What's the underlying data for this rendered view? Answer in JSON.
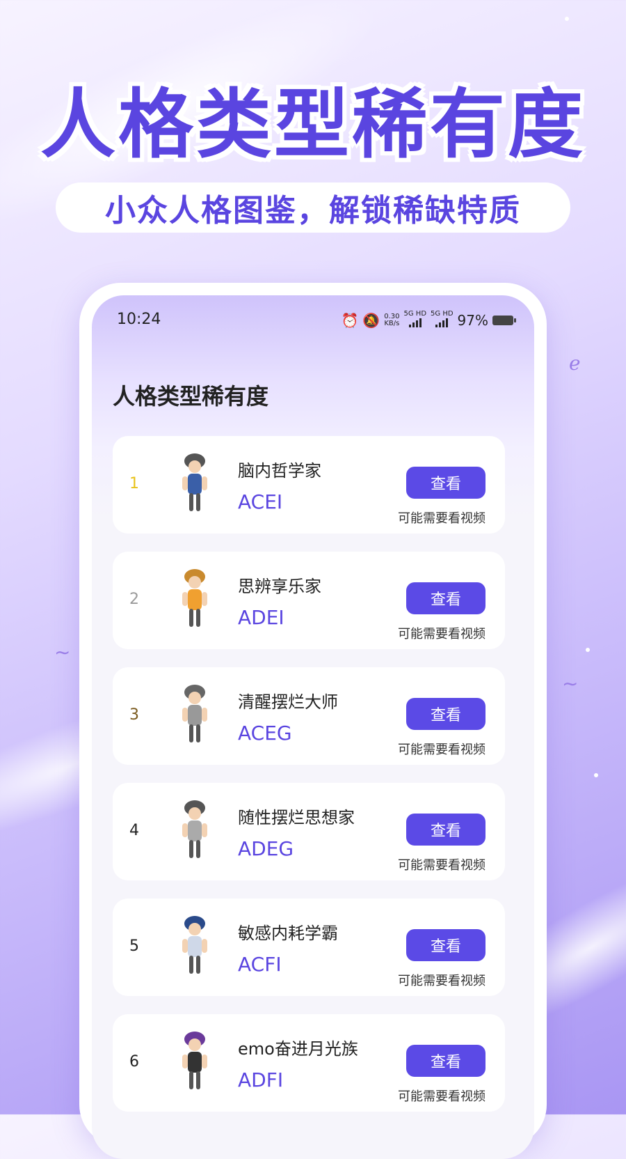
{
  "promo": {
    "headline": "人格类型稀有度",
    "subtitle": "小众人格图鉴，解锁稀缺特质"
  },
  "status_bar": {
    "time": "10:24",
    "speed_value": "0.30",
    "speed_unit": "KB/s",
    "net1": "5G HD",
    "net2": "5G HD",
    "battery": "97%"
  },
  "page_title": "人格类型稀有度",
  "colors": {
    "accent": "#5b4ae6",
    "rank1": "#e8c21a",
    "rank2": "#9a9a9a",
    "rank3": "#7a5a1e",
    "rank_default": "#222222"
  },
  "list": [
    {
      "rank": "1",
      "name": "脑内哲学家",
      "code": "ACEI",
      "button": "查看",
      "hint": "可能需要看视频",
      "icon": "avatar-philosopher-icon"
    },
    {
      "rank": "2",
      "name": "思辨享乐家",
      "code": "ADEI",
      "button": "查看",
      "hint": "可能需要看视频",
      "icon": "avatar-hedonist-icon"
    },
    {
      "rank": "3",
      "name": "清醒摆烂大师",
      "code": "ACEG",
      "button": "查看",
      "hint": "可能需要看视频",
      "icon": "avatar-slacker-icon"
    },
    {
      "rank": "4",
      "name": "随性摆烂思想家",
      "code": "ADEG",
      "button": "查看",
      "hint": "可能需要看视频",
      "icon": "avatar-thinker-icon"
    },
    {
      "rank": "5",
      "name": "敏感内耗学霸",
      "code": "ACFI",
      "button": "查看",
      "hint": "可能需要看视频",
      "icon": "avatar-scholar-icon"
    },
    {
      "rank": "6",
      "name": "emo奋进月光族",
      "code": "ADFI",
      "button": "查看",
      "hint": "可能需要看视频",
      "icon": "avatar-emo-icon"
    }
  ]
}
